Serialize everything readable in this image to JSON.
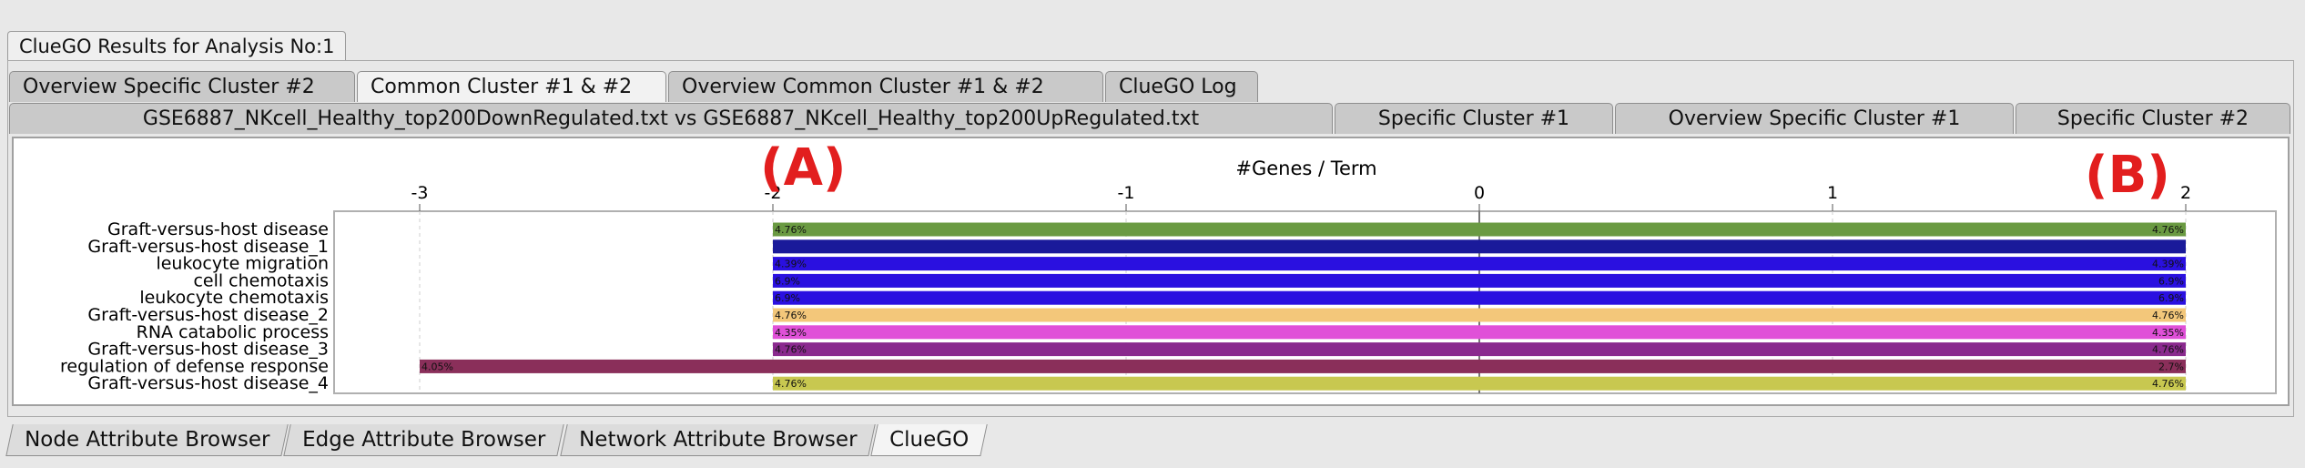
{
  "window": {
    "title_tab": "ClueGO Results for Analysis No:1"
  },
  "tabs_row1": [
    {
      "label": "Overview Specific Cluster #2",
      "active": false
    },
    {
      "label": "Common Cluster #1 & #2",
      "active": true
    },
    {
      "label": "Overview Common Cluster #1 & #2",
      "active": false
    },
    {
      "label": "ClueGO Log",
      "active": false
    }
  ],
  "tabs_row2": [
    {
      "label": "GSE6887_NKcell_Healthy_top200DownRegulated.txt vs GSE6887_NKcell_Healthy_top200UpRegulated.txt"
    },
    {
      "label": "Specific Cluster #1"
    },
    {
      "label": "Overview Specific Cluster #1"
    },
    {
      "label": "Specific Cluster #2"
    }
  ],
  "annotations": {
    "a": "(A)",
    "b": "(B)"
  },
  "chart_data": {
    "type": "bar",
    "title": "#Genes / Term",
    "xlim": [
      -3.25,
      2.25
    ],
    "xticks": [
      -3,
      -2,
      -1,
      0,
      1,
      2
    ],
    "grid": true,
    "series": [
      {
        "term": "Graft-versus-host disease",
        "left": -2,
        "right": 2,
        "left_label": "4.76%",
        "right_label": "4.76%",
        "color": "#6a9a42"
      },
      {
        "term": "Graft-versus-host disease_1",
        "left": -2,
        "right": 2,
        "left_label": "",
        "right_label": "",
        "color": "#1a1a9a"
      },
      {
        "term": "leukocyte migration",
        "left": -2,
        "right": 2,
        "left_label": "4.39%",
        "right_label": "4.39%",
        "color": "#2a10e0"
      },
      {
        "term": "cell chemotaxis",
        "left": -2,
        "right": 2,
        "left_label": "6.9%",
        "right_label": "6.9%",
        "color": "#2a10e0"
      },
      {
        "term": "leukocyte chemotaxis",
        "left": -2,
        "right": 2,
        "left_label": "6.9%",
        "right_label": "6.9%",
        "color": "#2a10e0"
      },
      {
        "term": "Graft-versus-host disease_2",
        "left": -2,
        "right": 2,
        "left_label": "4.76%",
        "right_label": "4.76%",
        "color": "#f3c77a"
      },
      {
        "term": "RNA catabolic process",
        "left": -2,
        "right": 2,
        "left_label": "4.35%",
        "right_label": "4.35%",
        "color": "#e050d8"
      },
      {
        "term": "Graft-versus-host disease_3",
        "left": -2,
        "right": 2,
        "left_label": "4.76%",
        "right_label": "4.76%",
        "color": "#8a2a8e"
      },
      {
        "term": "regulation of defense response",
        "left": -3,
        "right": 2,
        "left_label": "4.05%",
        "right_label": "2.7%",
        "color": "#8a2f5a"
      },
      {
        "term": "Graft-versus-host disease_4",
        "left": -2,
        "right": 2,
        "left_label": "4.76%",
        "right_label": "4.76%",
        "color": "#c8c850"
      }
    ]
  },
  "bottom_tabs": [
    {
      "label": "Node Attribute Browser",
      "active": false
    },
    {
      "label": "Edge Attribute Browser",
      "active": false
    },
    {
      "label": "Network Attribute Browser",
      "active": false
    },
    {
      "label": "ClueGO",
      "active": true
    }
  ]
}
